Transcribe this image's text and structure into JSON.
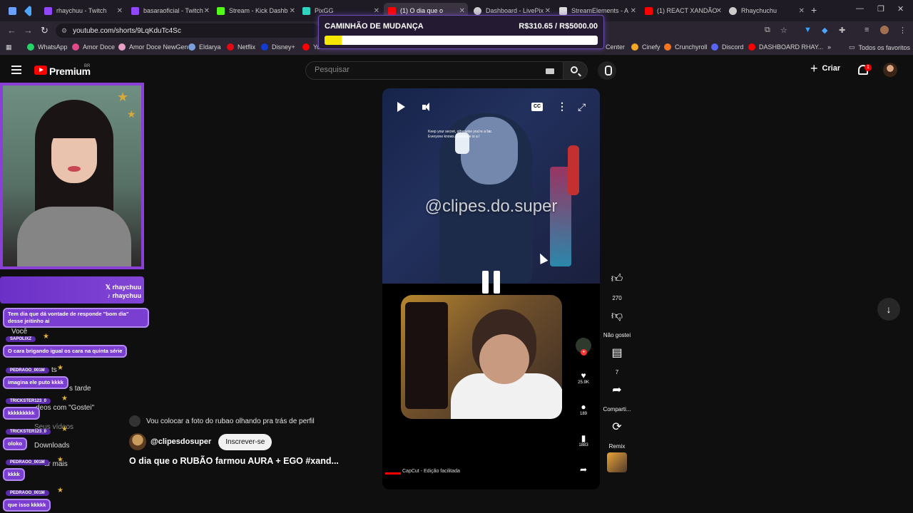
{
  "browser": {
    "tabs": [
      {
        "label": "rhaychuu - Twitch",
        "icon": "twitch-icon",
        "color": "#9146ff"
      },
      {
        "label": "basaraoficial - Twitch",
        "icon": "twitch-icon",
        "color": "#9146ff"
      },
      {
        "label": "Stream - Kick Dashb",
        "icon": "kick-icon",
        "color": "#53fc18"
      },
      {
        "label": "PixGG",
        "icon": "pixgg-icon",
        "color": "#2fd4c0"
      },
      {
        "label": "(1) O dia que o",
        "icon": "youtube-icon",
        "color": "#ff0000",
        "active": true
      },
      {
        "label": "Dashboard - LivePix",
        "icon": "globe-icon",
        "color": "#cccccc"
      },
      {
        "label": "StreamElements - A",
        "icon": "streamelements-icon",
        "color": "#dddddd"
      },
      {
        "label": "(1) REACT XANDÃO",
        "icon": "youtube-icon",
        "color": "#ff0000"
      },
      {
        "label": "Rhaychuchu",
        "icon": "globe-icon",
        "color": "#cccccc"
      }
    ],
    "url": "youtube.com/shorts/9LqKduTc4Sc",
    "bookmarks_left": [
      {
        "label": "WhatsApp",
        "color": "#25d366"
      },
      {
        "label": "Amor Doce",
        "color": "#e04a8a"
      },
      {
        "label": "Amor Doce NewGen",
        "color": "#e8a0c8"
      },
      {
        "label": "Eldarya",
        "color": "#7aa0e0"
      },
      {
        "label": "Netflix",
        "color": "#e50914"
      },
      {
        "label": "Disney+",
        "color": "#113ccf"
      },
      {
        "label": "Yo",
        "color": "#ff0000"
      }
    ],
    "bookmarks_right": [
      {
        "label": "Center",
        "color": "#555555"
      },
      {
        "label": "Cinefy",
        "color": "#f5a623"
      },
      {
        "label": "Crunchyroll",
        "color": "#f47521"
      },
      {
        "label": "Discord",
        "color": "#5865f2"
      },
      {
        "label": "DASHBOARD RHAY...",
        "color": "#ff0000"
      }
    ],
    "all_bookmarks": "Todos os favoritos"
  },
  "goal": {
    "title": "CAMINHÃO DE MUDANÇA",
    "amount": "R$310.65 / R$5000.00",
    "progress": 0.062
  },
  "youtube": {
    "brand": "Premium",
    "region": "BR",
    "search_placeholder": "Pesquisar",
    "create_label": "Criar",
    "notification_count": "1"
  },
  "stream_overlay": {
    "handles": [
      "rhaychuu",
      "rhaychuu"
    ],
    "messages": [
      {
        "text": "Tem dia que dá vontade de responde \"bom dia\" desse jeitinho ai"
      },
      {
        "user": "SAPOLIXZ",
        "text": "O cara brigando igual os cara na quinta série"
      },
      {
        "user": "PEDRAOO_001M",
        "text": "imagina ele puto kkkk"
      },
      {
        "user": "TRICKSTER123_0",
        "text": "kkkkkkkkk"
      },
      {
        "user": "TRICKSTER123_0",
        "text": "oloko"
      },
      {
        "user": "PEDRAOO_001M",
        "text": "kkkk"
      },
      {
        "user": "PEDRAOO_001M",
        "text": "que isso kkkkk"
      }
    ],
    "sidebar_peek": [
      "Você",
      "ts",
      "s tarde",
      "deos com \"Gostei\"",
      "Seus vídeos",
      "Downloads",
      "ar mais"
    ]
  },
  "short": {
    "watermark": "@clipes.do.super",
    "inner_caption": "Keep your secret, otherwise you're a liar. Everyone knows. Everyone is a l",
    "inner_counts": [
      "25.9K",
      "189",
      "1883"
    ],
    "inner_footer": "CapCut - Edição facilitada",
    "description": "Vou colocar a foto do rubao olhando pra trás de perfil",
    "channel": "@clipesdosuper",
    "subscribe": "Inscrever-se",
    "title": "O dia que o RUBÃO farmou AURA + EGO  #xand..."
  },
  "actions": {
    "likes": "270",
    "dislike_label": "Não gostei",
    "comments": "7",
    "share_label": "Comparti...",
    "remix_label": "Remix"
  }
}
